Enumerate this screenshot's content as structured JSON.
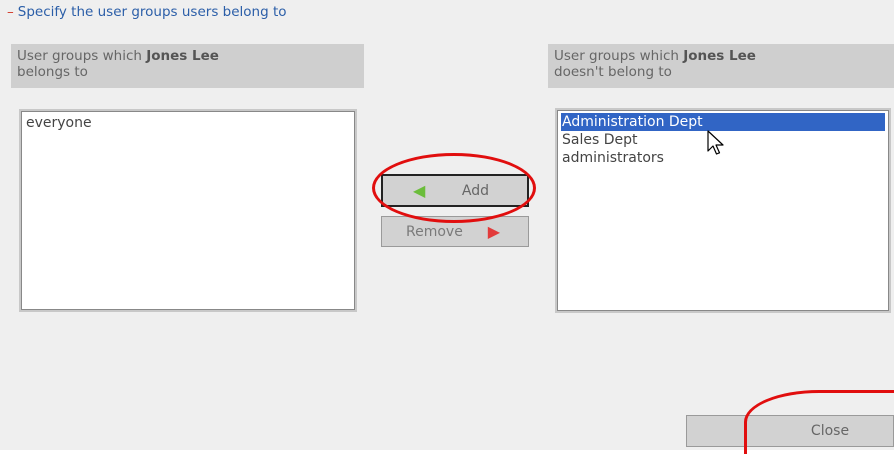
{
  "section": {
    "toggle": "–",
    "title": "Specify the user groups users belong to"
  },
  "user_name": "Jones Lee",
  "left_panel": {
    "header_prefix": "User groups which ",
    "header_suffix": "belongs to",
    "items": [
      "everyone"
    ]
  },
  "right_panel": {
    "header_prefix": "User groups which ",
    "header_suffix": "doesn't belong to",
    "items": [
      "Administration Dept",
      "Sales Dept",
      "administrators"
    ],
    "selected_item": "Administration Dept"
  },
  "buttons": {
    "add_label": "Add",
    "remove_label": "Remove",
    "close_label": "Close"
  },
  "icons": {
    "add_arrow": "arrow-left-icon",
    "remove_arrow": "arrow-right-icon",
    "cursor": "mouse-pointer-icon"
  },
  "colors": {
    "title_blue": "#2b5ea8",
    "selection_blue": "#3165c5",
    "annotation_red": "#e10e0e",
    "add_arrow_green": "#6bbd3b",
    "remove_arrow_red": "#e23b3b"
  }
}
